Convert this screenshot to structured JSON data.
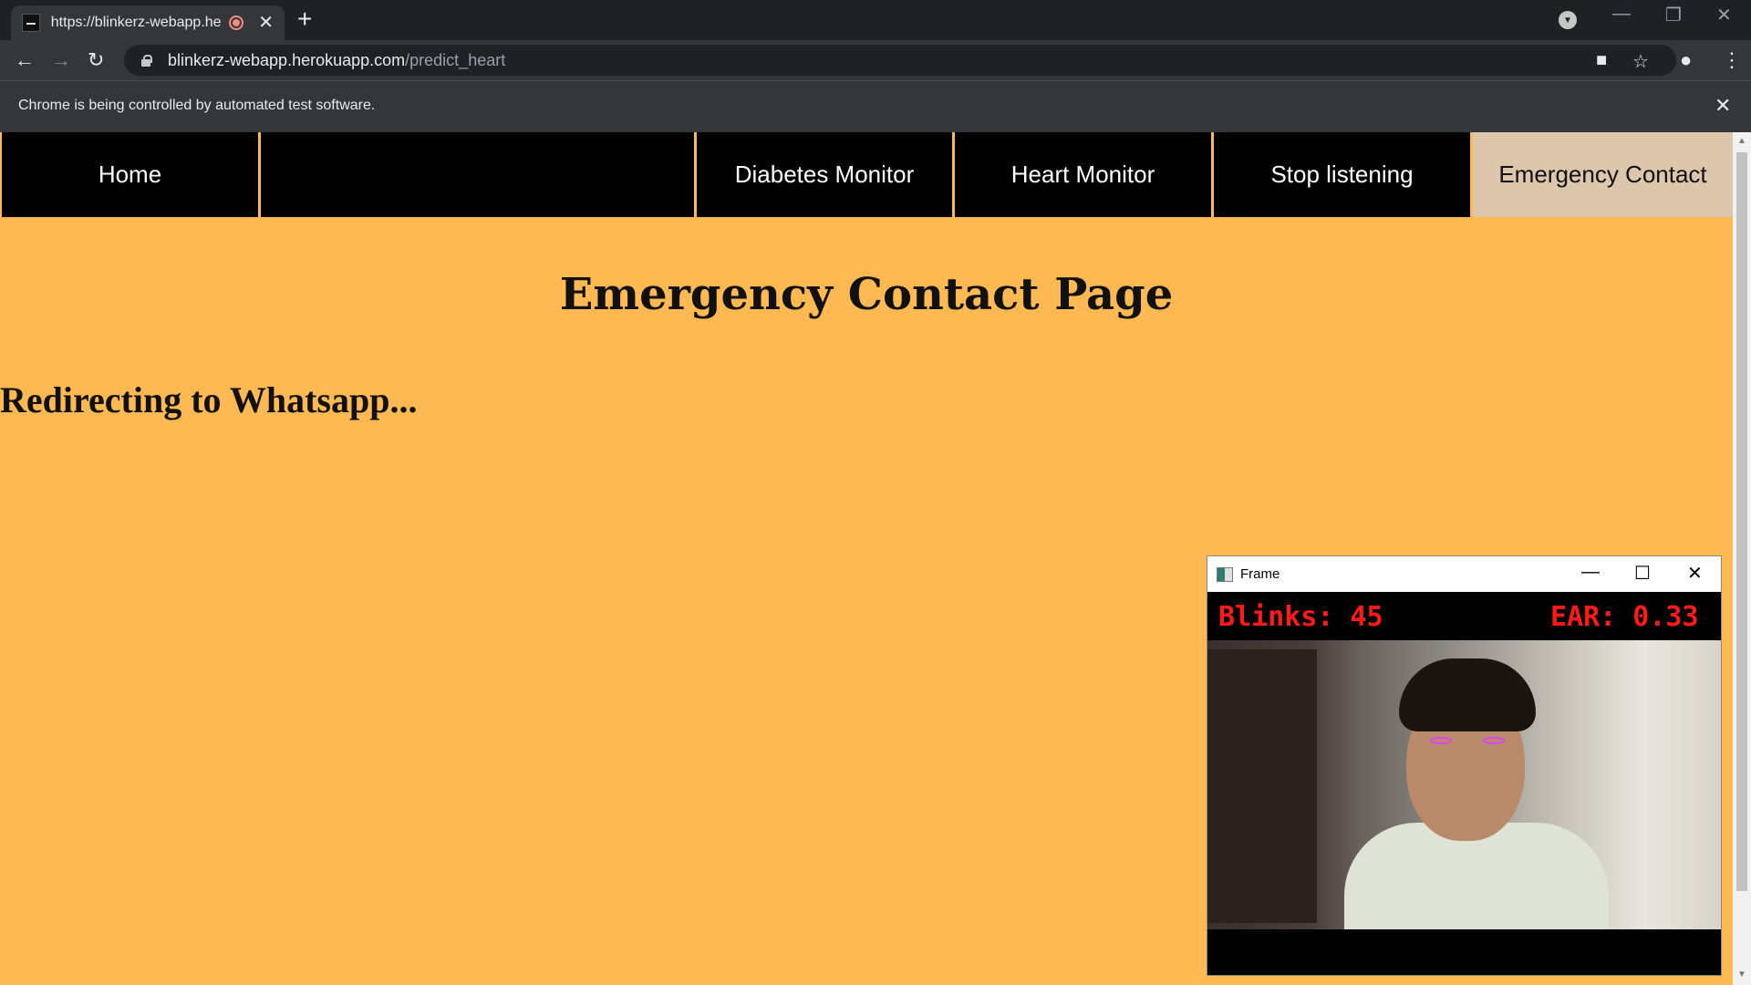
{
  "browser": {
    "tab_title": "https://blinkerz-webapp.herokuapp.com/predict_heart",
    "new_tab": "+",
    "tab_close": "✕",
    "url_host": "blinkerz-webapp.herokuapp.com",
    "url_path": "/predict_heart",
    "infobar_text": "Chrome is being controlled by automated test software.",
    "infobar_close": "✕"
  },
  "nav": {
    "items": [
      {
        "label": "Home",
        "active": false
      },
      {
        "label": "",
        "active": false
      },
      {
        "label": "Diabetes Monitor",
        "active": false
      },
      {
        "label": "Heart Monitor",
        "active": false
      },
      {
        "label": "Stop listening",
        "active": false
      },
      {
        "label": "Emergency Contact",
        "active": true
      }
    ]
  },
  "main": {
    "title": "Emergency Contact Page",
    "status": "Redirecting to Whatsapp..."
  },
  "frame_window": {
    "title": "Frame",
    "blinks": "Blinks: 45",
    "ear": "EAR: 0.33"
  },
  "colors": {
    "page_bg": "#ffb952",
    "nav_bg": "#000000",
    "nav_active_bg": "#dcc7ad",
    "overlay_text": "#ff1a1a",
    "eye_marker": "#e040fb"
  }
}
